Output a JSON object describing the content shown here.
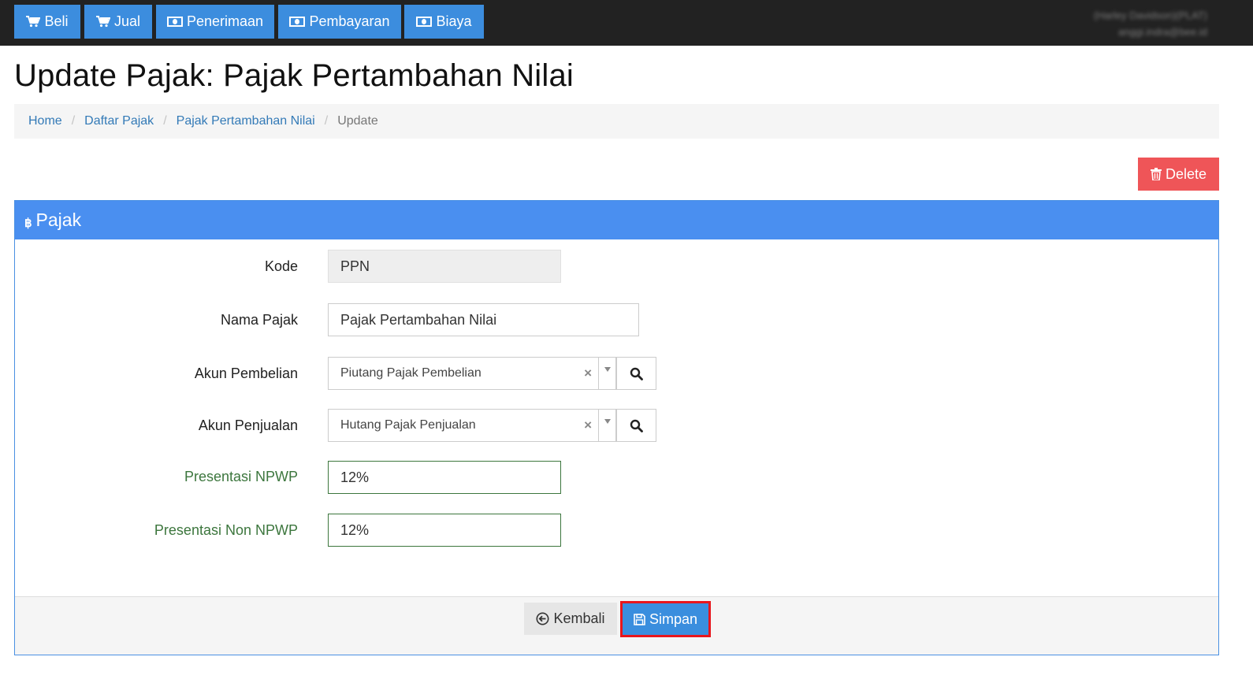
{
  "navbar": {
    "buttons": [
      {
        "label": "Beli",
        "icon": "cart-icon"
      },
      {
        "label": "Jual",
        "icon": "cart-icon"
      },
      {
        "label": "Penerimaan",
        "icon": "money-icon"
      },
      {
        "label": "Pembayaran",
        "icon": "money-icon"
      },
      {
        "label": "Biaya",
        "icon": "money-icon"
      }
    ],
    "user_name": "(Harley Davidson)(PLAT)",
    "user_email": "anggi.indra@bee.id"
  },
  "page": {
    "title": "Update Pajak: Pajak Pertambahan Nilai"
  },
  "breadcrumb": {
    "items": [
      "Home",
      "Daftar Pajak",
      "Pajak Pertambahan Nilai"
    ],
    "active": "Update",
    "separator": "/"
  },
  "actions": {
    "delete_label": "Delete"
  },
  "panel": {
    "title": "Pajak",
    "icon": "bitcoin-icon"
  },
  "form": {
    "kode": {
      "label": "Kode",
      "value": "PPN"
    },
    "nama_pajak": {
      "label": "Nama Pajak",
      "value": "Pajak Pertambahan Nilai"
    },
    "akun_pembelian": {
      "label": "Akun Pembelian",
      "value": "Piutang Pajak Pembelian"
    },
    "akun_penjualan": {
      "label": "Akun Penjualan",
      "value": "Hutang Pajak Penjualan"
    },
    "presentasi_npwp": {
      "label": "Presentasi NPWP",
      "value": "12%"
    },
    "presentasi_non_npwp": {
      "label": "Presentasi Non NPWP",
      "value": "12%"
    },
    "clear_symbol": "×"
  },
  "footer": {
    "back_label": "Kembali",
    "save_label": "Simpan"
  },
  "colors": {
    "navbar_bg": "#222222",
    "nav_button": "#3c8dde",
    "panel_heading": "#4a8ff0",
    "delete": "#ef5558",
    "success_text": "#3c763d",
    "highlight_border": "#e8161c"
  }
}
